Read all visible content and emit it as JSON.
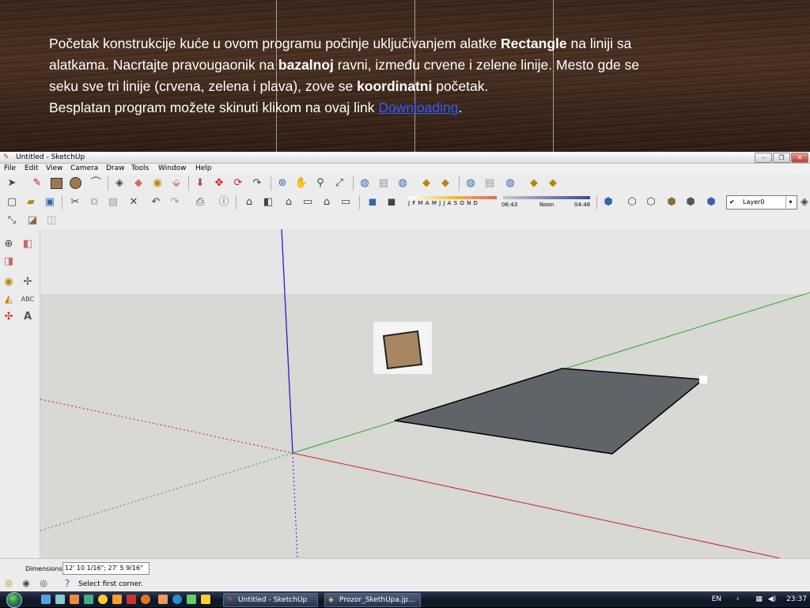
{
  "banner": {
    "line1_pre": "Početak konstrukcije kuće u ovom programu počinje uključivanjem alatke ",
    "line1_bold": "Rectangle",
    "line1_post": " na liniji sa",
    "line2_pre": "alatkama. Nacrtajte pravougaonik na ",
    "line2_bold": "bazalnoj",
    "line2_post": " ravni, između crvene i zelene linije. Mesto gde se",
    "line3_pre": "seku sve tri linije (crvena, zelena i plava), zove se ",
    "line3_bold": "koordinatni",
    "line3_post": " početak.",
    "line4_pre": "Besplatan program možete  skinuti klikom na ovaj link ",
    "link_text": "Downloading",
    "line4_post": "."
  },
  "window": {
    "title": "Untitled - SketchUp",
    "menu": [
      "File",
      "Edit",
      "View",
      "Camera",
      "Draw",
      "Tools",
      "Window",
      "Help"
    ]
  },
  "toolbar2": {
    "months": "J F M A M J J A S O N D",
    "time_start": "06:43",
    "time_mid": "Noon",
    "time_end": "04:46",
    "layer_value": "Layer0"
  },
  "status": {
    "dimensions_label": "Dimensions",
    "dimensions_value": "12' 10 1/16\"; 27' 5 9/16\"",
    "message": "Select first corner."
  },
  "taskbar": {
    "task1": "Untitled - SketchUp",
    "task2": "Prozor_SkethUpa.jp...",
    "lang": "EN",
    "clock": "23:37"
  },
  "colors": {
    "red_axis": "#c8202a",
    "green_axis": "#2aa82a",
    "blue_axis": "#2020c8",
    "face": "#5e6468",
    "link": "#2f5cff"
  }
}
